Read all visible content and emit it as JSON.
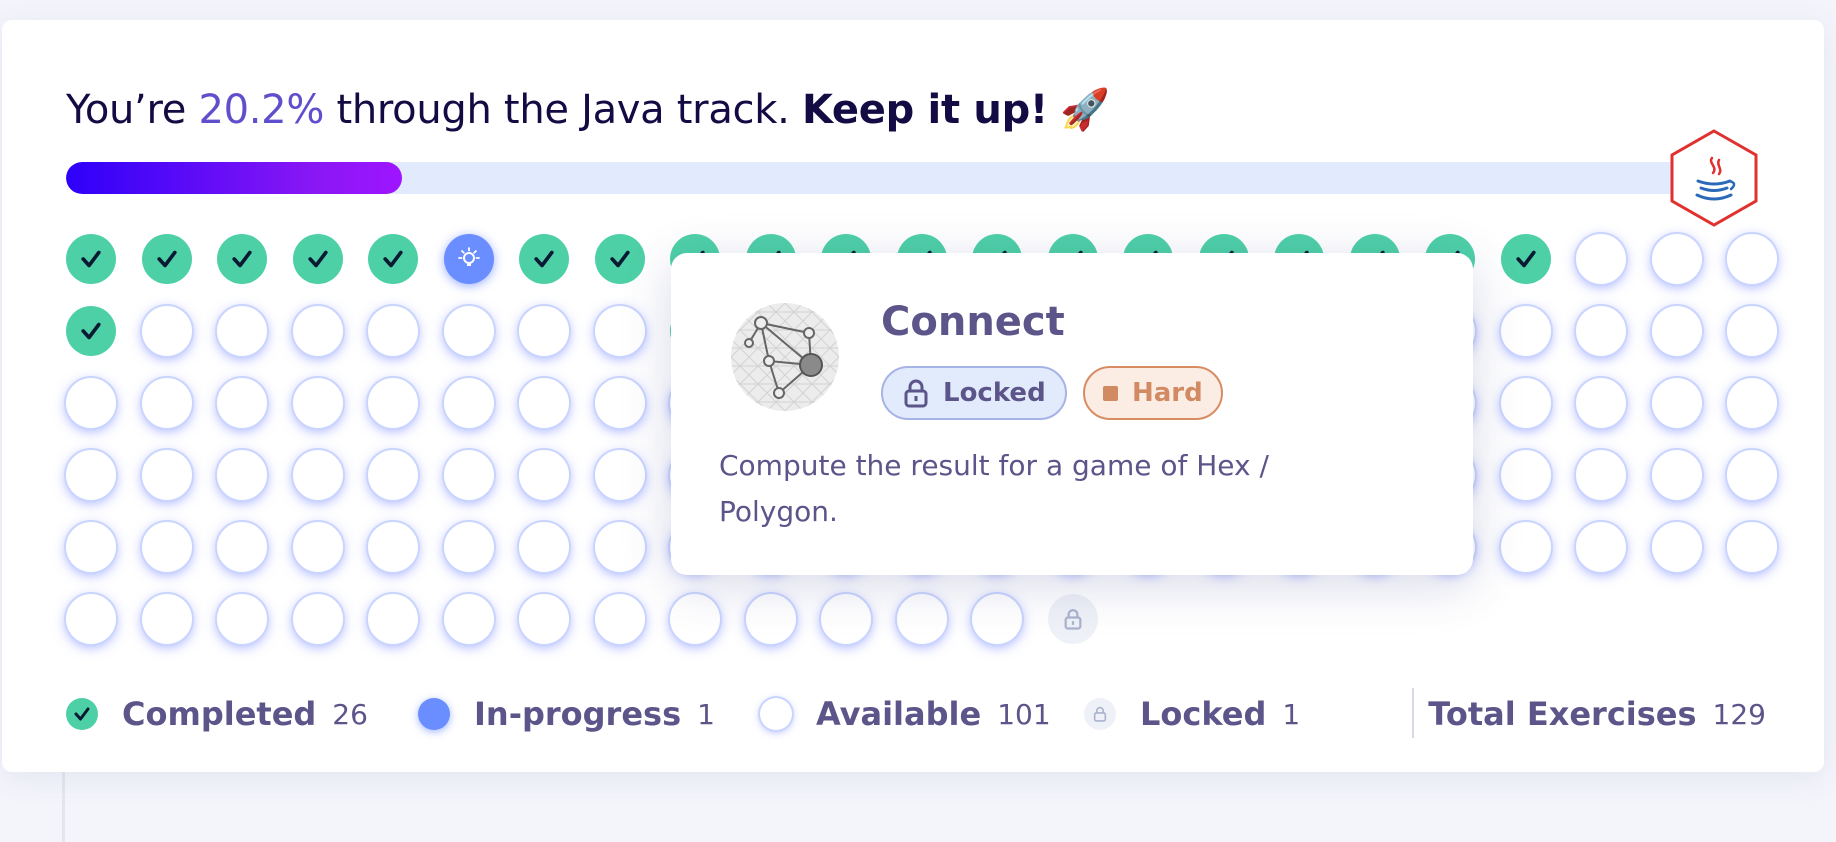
{
  "header": {
    "prefix": "You’re ",
    "percent": "20.2%",
    "middle": " through the Java track. ",
    "cheer": "Keep it up!",
    "emoji": "🚀",
    "progress_fraction": 0.202
  },
  "track_icon": "java-icon",
  "exercise_statuses": [
    "completed",
    "completed",
    "completed",
    "completed",
    "completed",
    "in-progress",
    "completed",
    "completed",
    "completed",
    "completed",
    "completed",
    "completed",
    "completed",
    "completed",
    "completed",
    "completed",
    "completed",
    "completed",
    "completed",
    "completed",
    "available",
    "available",
    "available",
    "completed",
    "available",
    "available",
    "available",
    "available",
    "available",
    "available",
    "available",
    "completed",
    "completed",
    "completed",
    "completed",
    "completed",
    "available",
    "available",
    "available",
    "available",
    "available",
    "available",
    "available",
    "available",
    "available",
    "available",
    "available",
    "available",
    "available",
    "available",
    "available",
    "available",
    "available",
    "available",
    "available",
    "available",
    "available",
    "available",
    "available",
    "available",
    "available",
    "available",
    "available",
    "available",
    "available",
    "available",
    "available",
    "available",
    "available",
    "available",
    "available",
    "available",
    "available",
    "available",
    "available",
    "available",
    "available",
    "available",
    "available",
    "available",
    "available",
    "available",
    "available",
    "available",
    "available",
    "available",
    "available",
    "available",
    "available",
    "available",
    "available",
    "available",
    "available",
    "available",
    "available",
    "available",
    "available",
    "available",
    "available",
    "available",
    "available",
    "available",
    "available",
    "available",
    "available",
    "available",
    "available",
    "available",
    "available",
    "available",
    "available",
    "available",
    "available",
    "available",
    "available",
    "available",
    "available",
    "available",
    "available",
    "available",
    "available",
    "available",
    "available",
    "available",
    "available",
    "available",
    "available",
    "available",
    "locked"
  ],
  "tooltip": {
    "title": "Connect",
    "locked_label": "Locked",
    "difficulty_label": "Hard",
    "description": "Compute the result for a game of Hex / Polygon.",
    "icon": "connect-graph-icon",
    "difficulty_color": "#d88c62"
  },
  "legend": {
    "completed_label": "Completed",
    "completed_count": "26",
    "in_progress_label": "In-progress",
    "in_progress_count": "1",
    "available_label": "Available",
    "available_count": "101",
    "locked_label": "Locked",
    "locked_count": "1",
    "total_label": "Total Exercises",
    "total_count": "129"
  },
  "colors": {
    "completed": "#4ed0a7",
    "in_progress": "#6a8dff",
    "accent": "#604fcd",
    "progress_start": "#2e00f9",
    "progress_end": "#9e15ff",
    "java_hex_border": "#e0312f"
  }
}
